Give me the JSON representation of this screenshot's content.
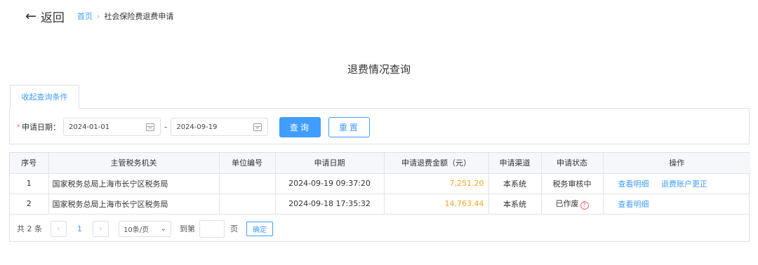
{
  "nav": {
    "back_arrow": "←",
    "back_label": "返回",
    "breadcrumb_home": "首页",
    "breadcrumb_sep": "›",
    "breadcrumb_current": "社会保险费退费申请"
  },
  "page_title": "退费情况查询",
  "filter": {
    "tab_label": "收起查询条件",
    "required_mark": "*",
    "date_label": "申请日期：",
    "start_date": "2024-01-01",
    "range_sep": "-",
    "end_date": "2024-09-19",
    "query_button": "查询",
    "reset_button": "重置"
  },
  "table": {
    "headers": [
      "序号",
      "主管税务机关",
      "单位编号",
      "申请日期",
      "申请退费金额（元）",
      "申请渠道",
      "申请状态",
      "操作"
    ],
    "rows": [
      {
        "index": "1",
        "authority": "国家税务总局上海市长宁区税务局",
        "unit_code": "",
        "date": "2024-09-19 09:37:20",
        "amount": "7,251.20",
        "channel": "本系统",
        "status": "税务审核中",
        "action_view": "查看明细",
        "action_fix": "退费账户更正"
      },
      {
        "index": "2",
        "authority": "国家税务总局上海市长宁区税务局",
        "unit_code": "",
        "date": "2024-09-18 17:35:32",
        "amount": "14,763.44",
        "channel": "本系统",
        "status": "已作废",
        "status_help": "?",
        "action_view": "查看明细"
      }
    ]
  },
  "pagination": {
    "total_text": "共 2 条",
    "prev": "‹",
    "current_page": "1",
    "next": "›",
    "page_size": "10条/页",
    "page_size_caret": "⌄",
    "goto_label": "到第",
    "goto_value": "",
    "page_unit": "页",
    "confirm": "确定"
  },
  "colors": {
    "accent": "#409eff",
    "amount": "#f5a623",
    "warning": "#f56c6c"
  }
}
